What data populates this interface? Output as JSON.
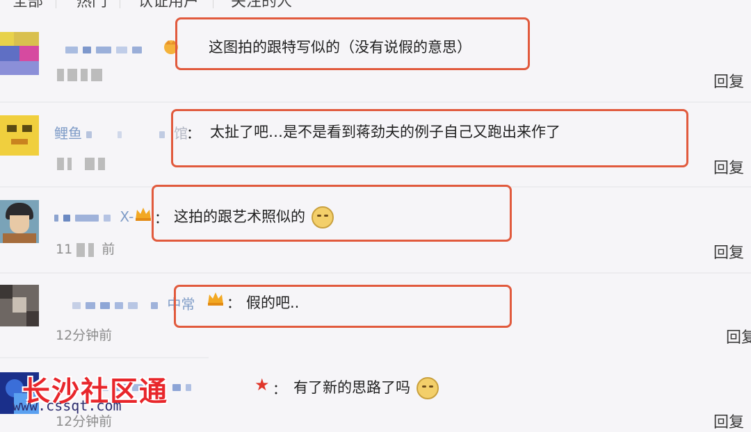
{
  "tabs": [
    "全部",
    "热门",
    "认证用户",
    "关注的人"
  ],
  "comments": [
    {
      "name_suffix": "",
      "text": "这图拍的跟特写似的（没有说假的意思）",
      "time": "",
      "reply": "回复",
      "emoji": ""
    },
    {
      "name_prefix": "鲤鱼",
      "name_suffix": "馆",
      "text": "太扯了吧…是不是看到蒋劲夫的例子自己又跑出来作了",
      "time": "",
      "reply": "回复",
      "emoji": ""
    },
    {
      "name_suffix": "X-",
      "text": "这拍的跟艺术照似的",
      "time": "11",
      "time_suffix": "前",
      "reply": "回复",
      "emoji": "smirk-emoji"
    },
    {
      "name_suffix": "中常",
      "text": "假的吧..",
      "time": "12分钟前",
      "reply": "回复",
      "emoji": ""
    },
    {
      "name_suffix": "",
      "text": "有了新的思路了吗",
      "time": "12分钟前",
      "reply": "回复",
      "emoji": "grin-emoji"
    }
  ],
  "watermark": {
    "title": "长沙社区通",
    "url": "www.cssqt.com"
  },
  "colors": {
    "highlight_box": "#e15a3d",
    "username": "#7f9cc7",
    "crown": "#f0a020"
  }
}
